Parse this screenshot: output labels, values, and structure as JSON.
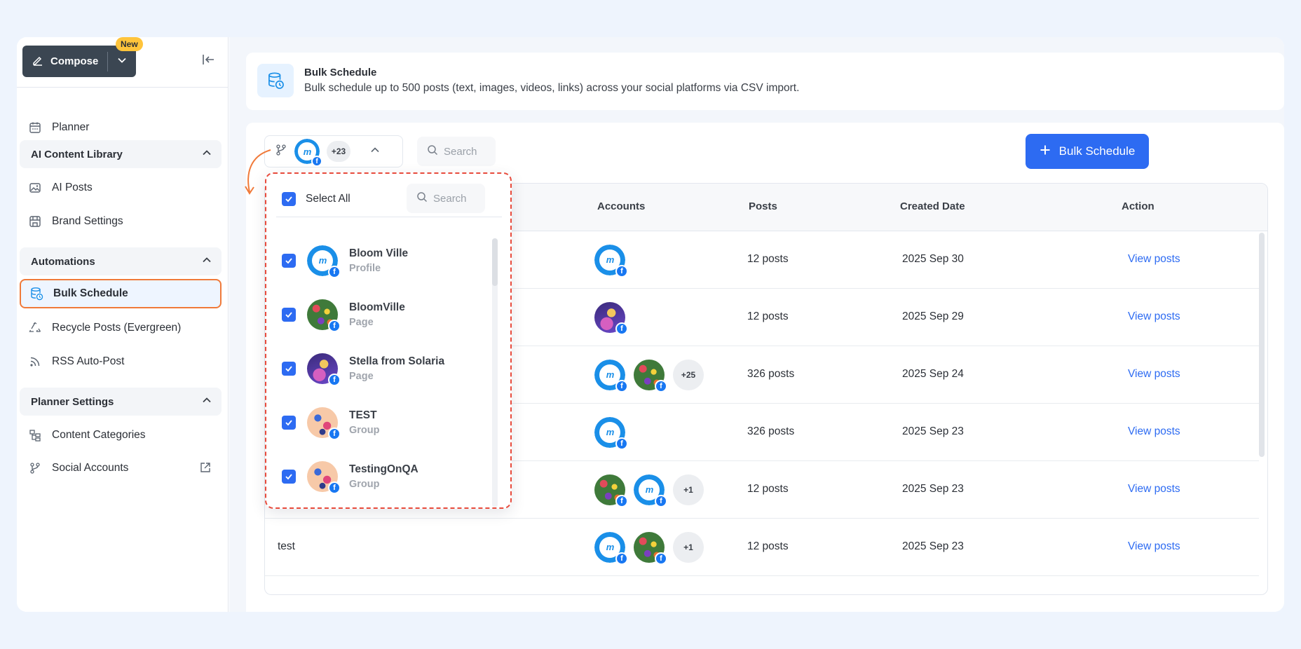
{
  "sidebar": {
    "compose_label": "Compose",
    "new_badge": "New",
    "planner": "Planner",
    "sections": {
      "ai_library": "AI Content Library",
      "automations": "Automations",
      "planner_settings": "Planner Settings"
    },
    "items": {
      "ai_posts": "AI Posts",
      "brand_settings": "Brand Settings",
      "bulk_schedule": "Bulk Schedule",
      "recycle_posts": "Recycle Posts (Evergreen)",
      "rss": "RSS Auto-Post",
      "content_categories": "Content Categories",
      "social_accounts": "Social Accounts"
    }
  },
  "banner": {
    "title": "Bulk Schedule",
    "description": "Bulk schedule up to 500 posts (text, images, videos, links) across your social platforms via CSV import."
  },
  "toolbar": {
    "accounts_more": "+23",
    "search_placeholder": "Search",
    "bulk_button": "Bulk Schedule"
  },
  "table": {
    "headers": {
      "accounts": "Accounts",
      "posts": "Posts",
      "created": "Created Date",
      "action": "Action"
    },
    "rows": [
      {
        "name": "",
        "posts": "12 posts",
        "date": "2025 Sep 30",
        "action": "View posts",
        "more": ""
      },
      {
        "name": "",
        "posts": "12 posts",
        "date": "2025 Sep 29",
        "action": "View posts",
        "more": ""
      },
      {
        "name": "",
        "posts": "326 posts",
        "date": "2025 Sep 24",
        "action": "View posts",
        "more": "+25"
      },
      {
        "name": "",
        "posts": "326 posts",
        "date": "2025 Sep 23",
        "action": "View posts",
        "more": ""
      },
      {
        "name": "",
        "posts": "12 posts",
        "date": "2025 Sep 23",
        "action": "View posts",
        "more": "+1"
      },
      {
        "name": "test",
        "posts": "12 posts",
        "date": "2025 Sep 23",
        "action": "View posts",
        "more": "+1"
      }
    ]
  },
  "dropdown": {
    "select_all": "Select All",
    "search_placeholder": "Search",
    "accounts": [
      {
        "name": "Bloom Ville",
        "type": "Profile"
      },
      {
        "name": "BloomVille",
        "type": "Page"
      },
      {
        "name": "Stella from Solaria",
        "type": "Page"
      },
      {
        "name": "TEST",
        "type": "Group"
      },
      {
        "name": "TestingOnQA",
        "type": "Group"
      }
    ]
  },
  "colors": {
    "primary": "#2d6bf2",
    "active_border": "#f07a3a",
    "dropdown_border": "#e84b3c",
    "facebook": "#1877f2",
    "new_badge": "#ffc43b"
  }
}
